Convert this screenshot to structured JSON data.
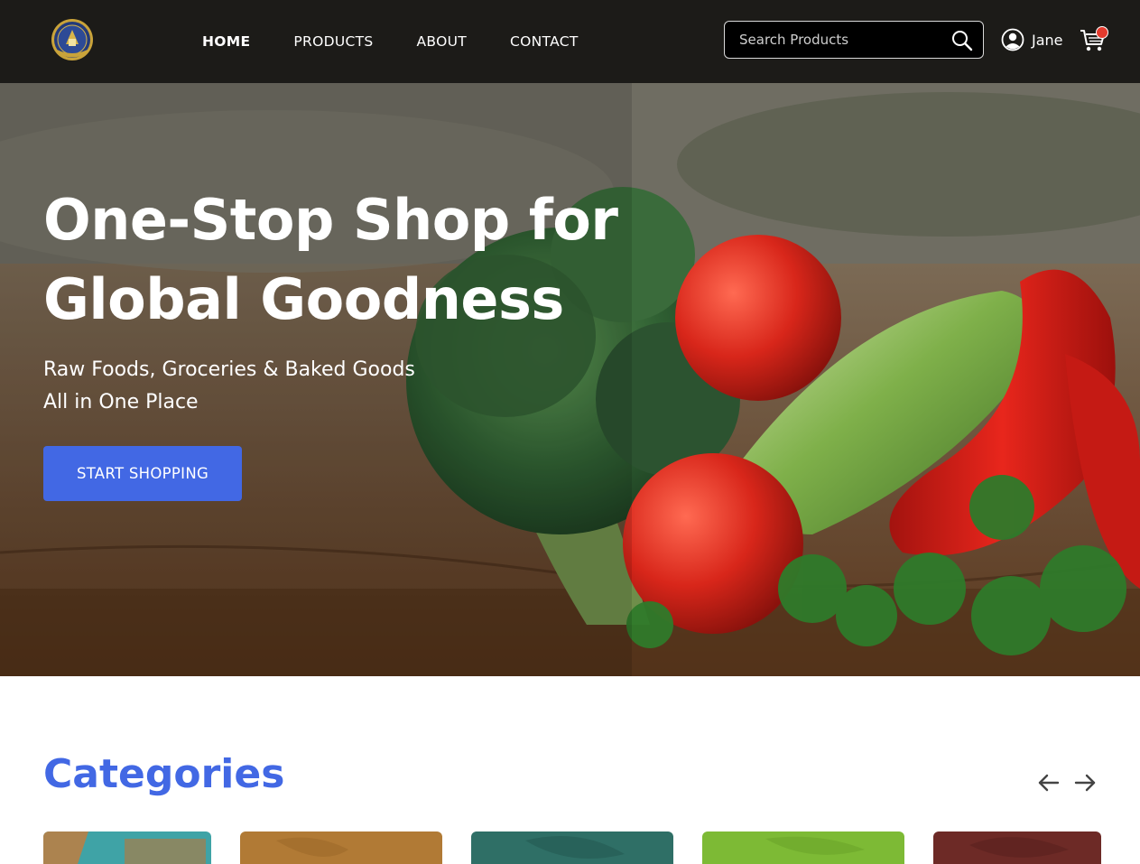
{
  "header": {
    "logo_name": "store-crest-logo",
    "nav": [
      {
        "label": "HOME",
        "active": true
      },
      {
        "label": "PRODUCTS",
        "active": false
      },
      {
        "label": "ABOUT",
        "active": false
      },
      {
        "label": "CONTACT",
        "active": false
      }
    ],
    "search": {
      "placeholder": "Search Products",
      "value": ""
    },
    "user": {
      "name": "Jane"
    },
    "cart": {
      "has_badge": true,
      "badge_color": "#e33b2e"
    }
  },
  "hero": {
    "title_line1": "One-Stop Shop for",
    "title_line2": "Global Goodness",
    "subtitle_line1": "Raw Foods, Groceries & Baked Goods",
    "subtitle_line2": "All in One Place",
    "cta_label": "START SHOPPING"
  },
  "categories": {
    "title": "Categories",
    "card_colors": [
      "#3fa3a6",
      "#b17a35",
      "#2f6f66",
      "#7dba35",
      "#6d2a26"
    ]
  },
  "colors": {
    "header_bg": "#1c1b18",
    "accent": "#4268e4"
  }
}
